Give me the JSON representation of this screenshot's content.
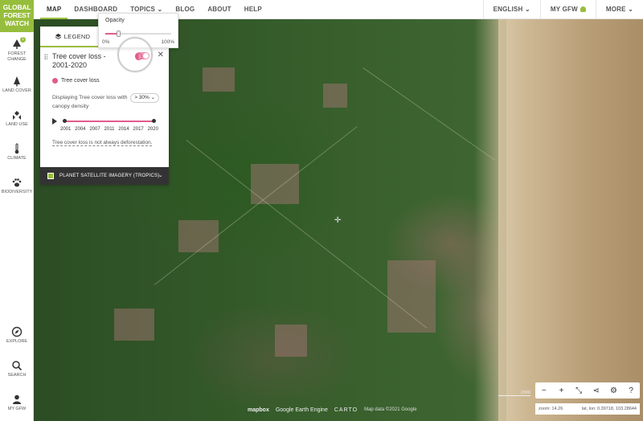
{
  "logo": {
    "line1": "GLOBAL",
    "line2": "FOREST",
    "line3": "WATCH"
  },
  "nav": {
    "items": [
      {
        "label": "MAP"
      },
      {
        "label": "DASHBOARD"
      },
      {
        "label": "TOPICS"
      },
      {
        "label": "BLOG"
      },
      {
        "label": "ABOUT"
      },
      {
        "label": "HELP"
      }
    ],
    "language": "ENGLISH",
    "my_gfw": "MY GFW",
    "more": "MORE"
  },
  "sidebar": {
    "items": [
      {
        "label": "FOREST CHANGE",
        "badge": "1",
        "icon": "tree-change-icon"
      },
      {
        "label": "LAND COVER",
        "icon": "tree-icon"
      },
      {
        "label": "LAND USE",
        "icon": "land-use-icon"
      },
      {
        "label": "CLIMATE",
        "icon": "thermometer-icon"
      },
      {
        "label": "BIODIVERSITY",
        "icon": "paw-icon"
      }
    ],
    "bottom": [
      {
        "label": "EXPLORE",
        "icon": "compass-icon"
      },
      {
        "label": "SEARCH",
        "icon": "search-icon"
      },
      {
        "label": "MY GFW",
        "icon": "user-icon"
      }
    ]
  },
  "opacity": {
    "label": "Opacity",
    "min": "0%",
    "max": "100%",
    "value": 0.2
  },
  "legend": {
    "tab": "LEGEND",
    "layer_title": "Tree cover loss - 2001-2020",
    "key_label": "Tree cover loss",
    "desc_prefix": "Displaying Tree cover loss with",
    "threshold": "> 30%",
    "desc_suffix": "canopy density",
    "years": [
      "2001",
      "2004",
      "2007",
      "2011",
      "2014",
      "2017",
      "2020"
    ],
    "warning": "Tree cover loss is not always deforestation.",
    "basemap": "PLANET SATELLITE IMAGERY (TROPICS)"
  },
  "attribution": {
    "mapbox": "mapbox",
    "google": "Google Earth Engine",
    "carto": "CARTO",
    "mapdata": "Map data ©2021 Google"
  },
  "scale": {
    "label": "2000"
  },
  "controls": {
    "zoom": "zoom: 14.26",
    "latlon": "lat, lon: 0.39718, 103.28644"
  },
  "colors": {
    "brand": "#97bd3d",
    "loss": "#e15c8c"
  }
}
